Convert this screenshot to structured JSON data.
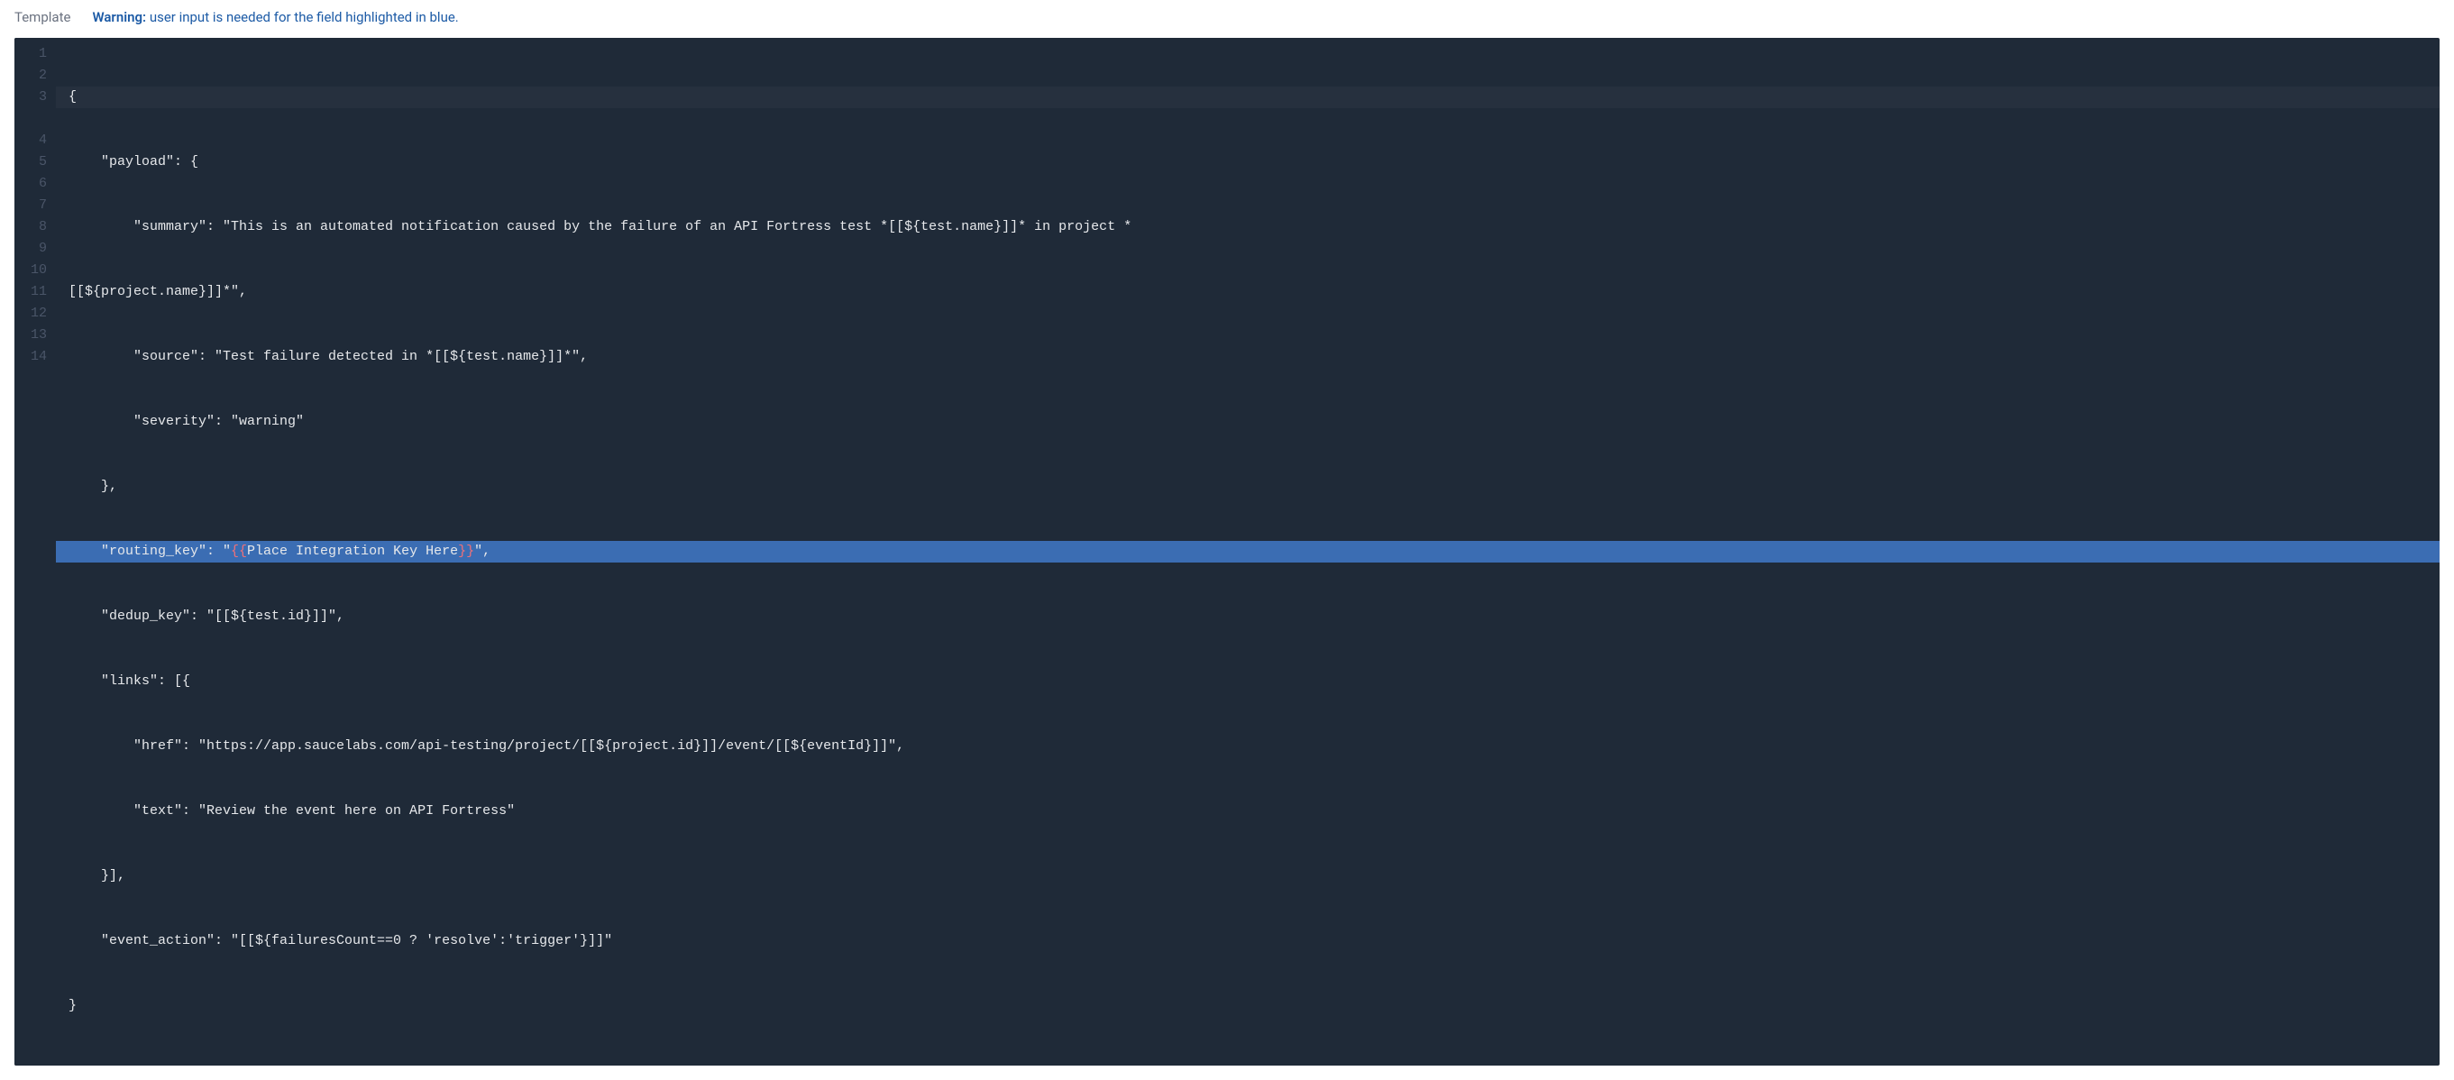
{
  "header": {
    "template_label": "Template",
    "warning_label": "Warning:",
    "warning_text": " user input is needed for the field highlighted in blue."
  },
  "code": {
    "total_lines": 14,
    "highlighted_line": 7,
    "lines": {
      "l1": "{",
      "l2": "    \"payload\": {",
      "l3": "        \"summary\": \"This is an automated notification caused by the failure of an API Fortress test *[[${test.name}]]* in project *",
      "l3b": "[[${project.name}]]*\",",
      "l4": "        \"source\": \"Test failure detected in *[[${test.name}]]*\",",
      "l5": "        \"severity\": \"warning\"",
      "l6": "    },",
      "l7_prefix": "    \"routing_key\": \"",
      "l7_open": "{{",
      "l7_mid": "Place Integration Key Here",
      "l7_close": "}}",
      "l7_suffix": "\",",
      "l8": "    \"dedup_key\": \"[[${test.id}]]\",",
      "l9": "    \"links\": [{",
      "l10": "        \"href\": \"https://app.saucelabs.com/api-testing/project/[[${project.id}]]/event/[[${eventId}]]\",",
      "l11": "        \"text\": \"Review the event here on API Fortress\"",
      "l12": "    }],",
      "l13": "    \"event_action\": \"[[${failuresCount==0 ? 'resolve':'trigger'}]]\"",
      "l14": "}"
    }
  }
}
